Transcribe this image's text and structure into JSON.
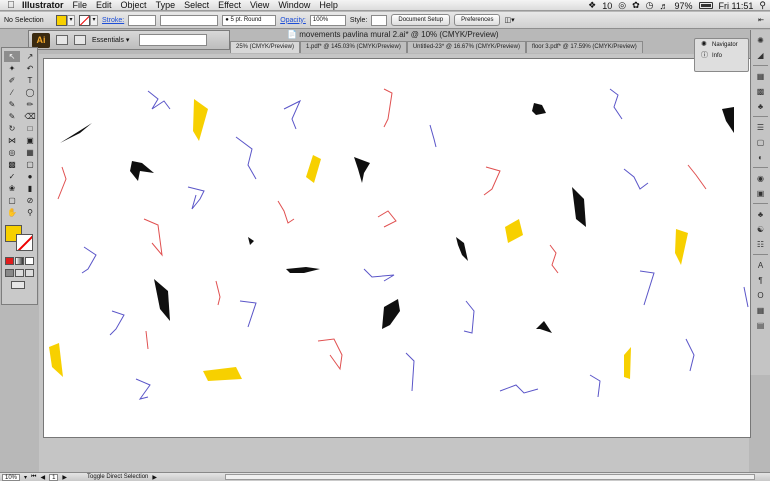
{
  "menubar": {
    "app_name": "Illustrator",
    "menus": [
      "File",
      "Edit",
      "Object",
      "Type",
      "Select",
      "Effect",
      "View",
      "Window",
      "Help"
    ],
    "status_items": [
      "97%",
      "Fri 11:51"
    ],
    "badge": "10"
  },
  "controlbar": {
    "selection_label": "No Selection",
    "stroke_label": "Stroke:",
    "stroke_weight": "5 pt. Round",
    "opacity_label": "Opacity:",
    "opacity_value": "100%",
    "style_label": "Style:",
    "document_setup_label": "Document Setup",
    "preferences_label": "Preferences"
  },
  "appbar": {
    "logo": "Ai",
    "workspace": "Essentials"
  },
  "document": {
    "title": "movements pavlina mural 2.ai* @ 10% (CMYK/Preview)",
    "tabs": [
      "25% (CMYK/Preview)",
      "1.pdf* @ 145.03% (CMYK/Preview)",
      "Untitled-23* @ 16.67% (CMYK/Preview)",
      "floor 3.pdf* @ 17.59% (CMYK/Preview)"
    ]
  },
  "navigator_popup": {
    "items": [
      {
        "label": "Navigator",
        "icon": "navigator-icon"
      },
      {
        "label": "Info",
        "icon": "info-icon"
      }
    ]
  },
  "statusbar": {
    "zoom": "10%",
    "page": "1",
    "tool_hint": "Toggle Direct Selection"
  },
  "colors": {
    "fill": "#f7d000",
    "accent_red": "#e11d1d",
    "stick_blue": "#5a55c8",
    "stick_red": "#e05050"
  }
}
